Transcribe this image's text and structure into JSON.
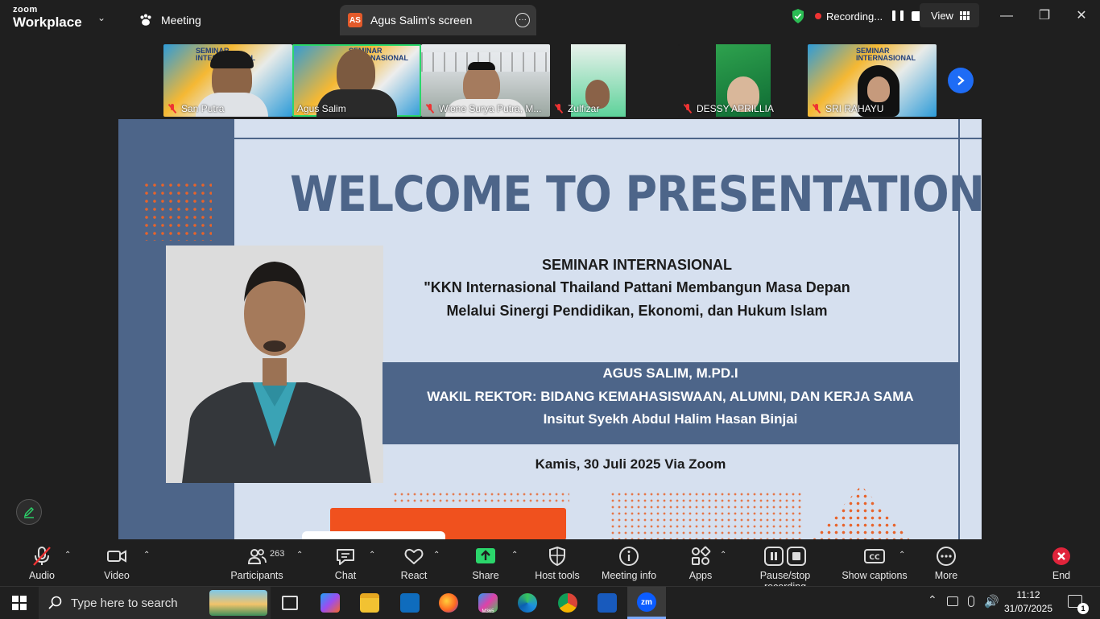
{
  "app": {
    "brand_top": "zoom",
    "brand_bottom": "Workplace",
    "tabs": [
      {
        "label": "Meeting"
      },
      {
        "label": "Agus Salim's screen",
        "badge": "AS"
      }
    ],
    "recording_label": "Recording...",
    "view_label": "View"
  },
  "participants_strip": [
    {
      "name": "San Putra",
      "muted": true
    },
    {
      "name": "Agus Salim",
      "muted": false,
      "active": true
    },
    {
      "name": "Wiene Surya Putra, M...",
      "muted": true
    },
    {
      "name": "Zulfizar",
      "muted": true
    },
    {
      "name": "DESSY APRILLIA",
      "muted": true
    },
    {
      "name": "SRI RAHAYU",
      "muted": true
    }
  ],
  "thumb_text": {
    "seminar": "SEMINAR",
    "intl": "INTERNASIONAL"
  },
  "slide": {
    "welcome": "WELCOME TO PRESENTATION",
    "seminar": "SEMINAR INTERNASIONAL",
    "theme_line1": "\"KKN Internasional Thailand Pattani Membangun Masa Depan",
    "theme_line2": "Melalui Sinergi Pendidikan, Ekonomi, dan Hukum Islam",
    "speaker_name": "AGUS SALIM, M.PD.I",
    "speaker_role": "WAKIL REKTOR: BIDANG KEMAHASISWAAN, ALUMNI, DAN KERJA SAMA",
    "speaker_org": "Insitut Syekh Abdul Halim Hasan Binjai",
    "date": "Kamis, 30 Juli 2025 Via Zoom"
  },
  "toolbar": {
    "audio": "Audio",
    "video": "Video",
    "participants": "Participants",
    "participants_count": "263",
    "chat": "Chat",
    "react": "React",
    "share": "Share",
    "host_tools": "Host tools",
    "meeting_info": "Meeting info",
    "apps": "Apps",
    "pause_recording": "Pause/stop recording",
    "captions": "Show captions",
    "more": "More",
    "end": "End"
  },
  "taskbar": {
    "search_placeholder": "Type here to search",
    "time": "11:12",
    "date": "31/07/2025",
    "notifications": "1",
    "m365_label": "M365"
  },
  "colors": {
    "slide_blue": "#4d6589",
    "slide_bg": "#d6e0ef",
    "accent_orange": "#f0511e",
    "active_green": "#2bd66b",
    "next_blue": "#1e6cf5"
  }
}
